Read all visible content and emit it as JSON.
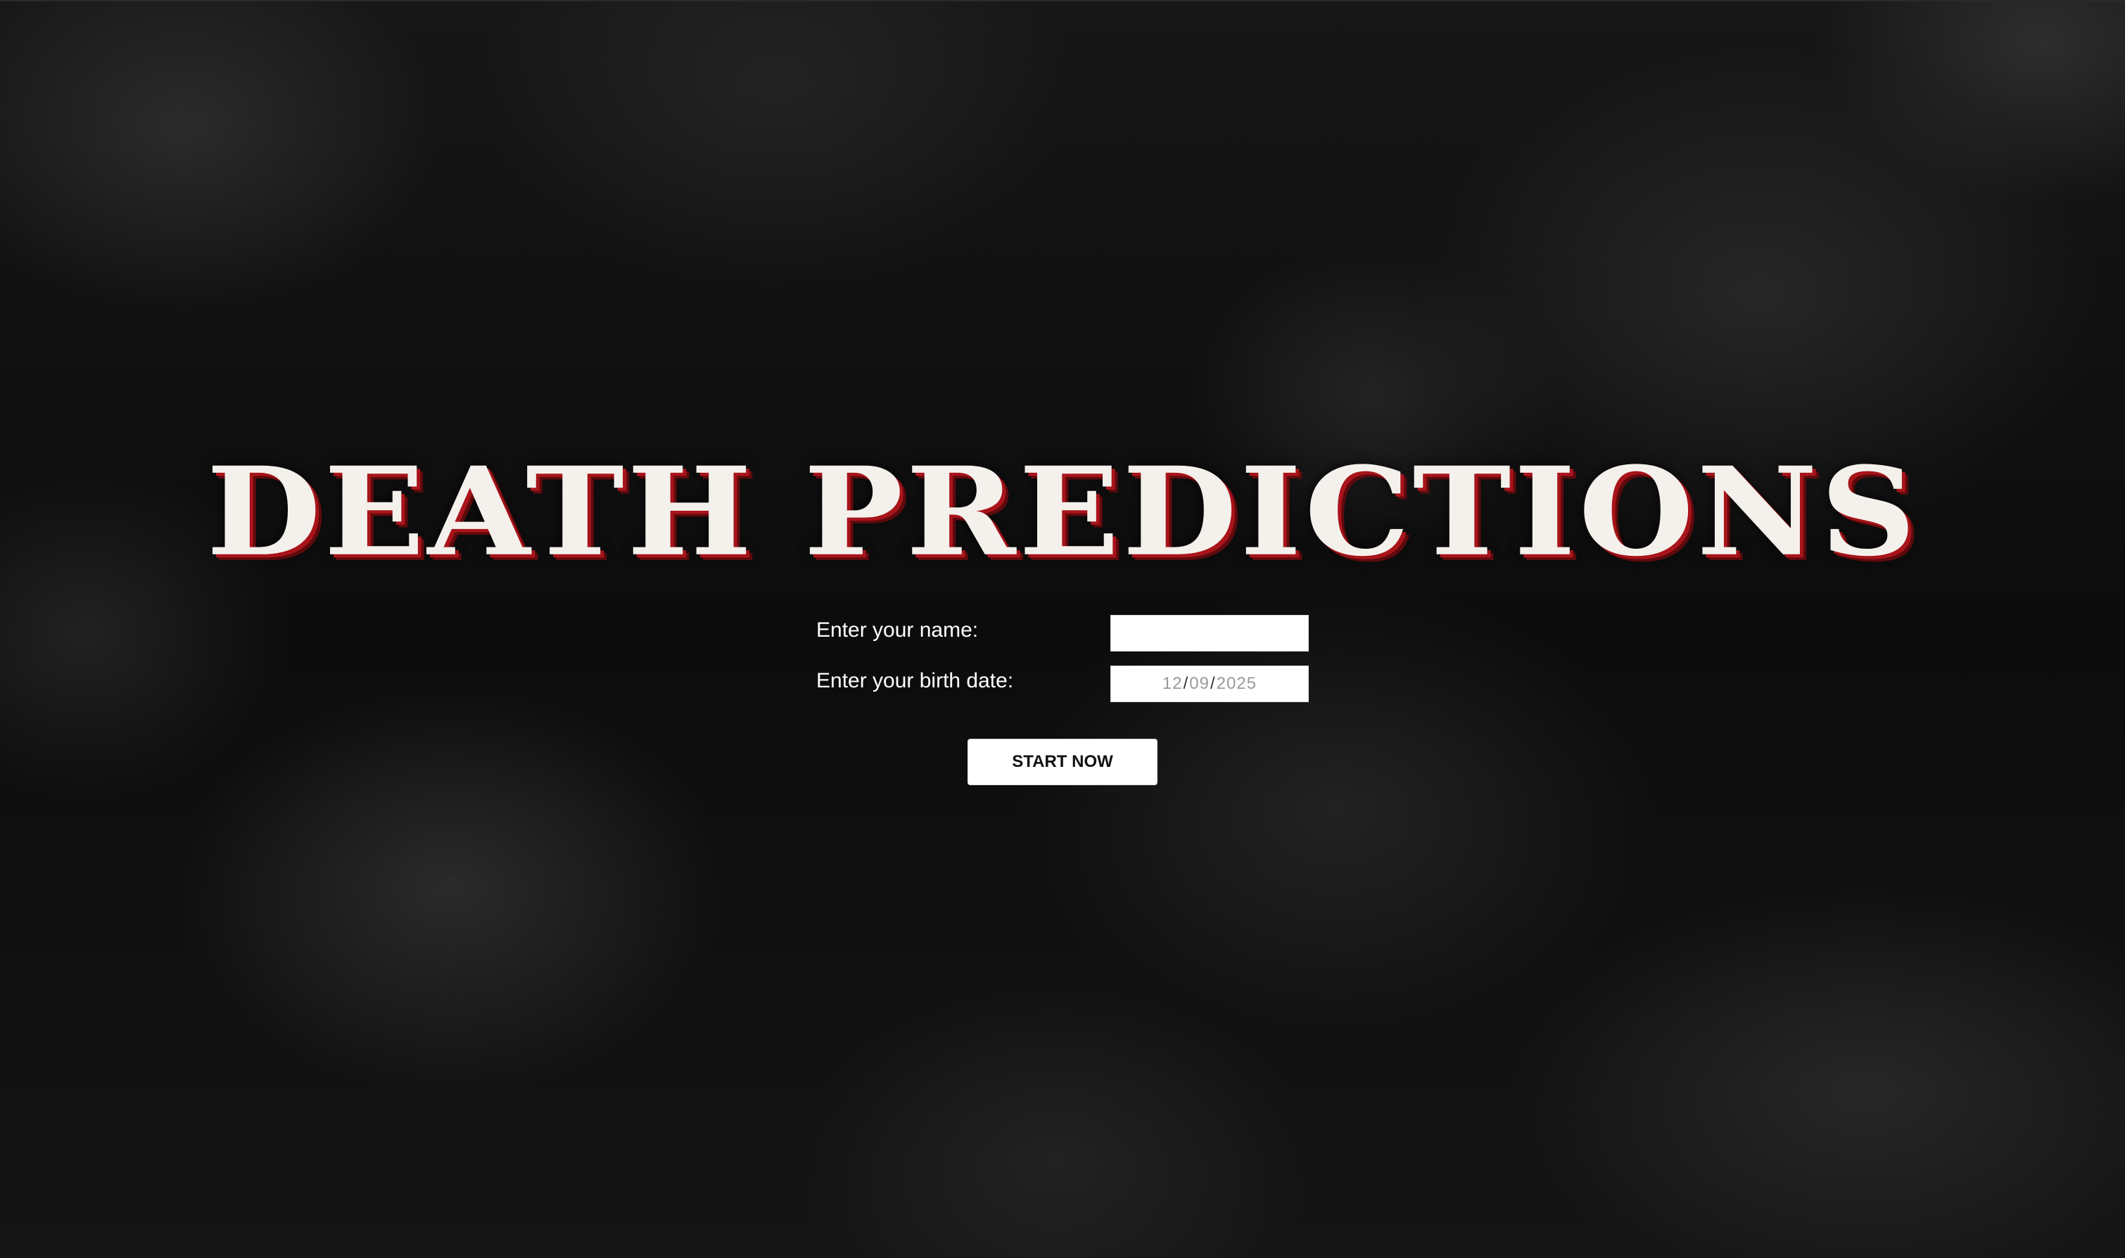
{
  "title": "DEATH PREDICTIONS",
  "form": {
    "name_label": "Enter your name:",
    "name_value": "",
    "birth_label": "Enter your birth date:",
    "birth_month": "12",
    "birth_day": "09",
    "birth_year": "2025",
    "date_separator": "/"
  },
  "start_button_label": "START NOW",
  "colors": {
    "background": "#121212",
    "title_fill": "#f4f1ec",
    "title_shadow": "#a8141a",
    "button_bg": "#ffffff",
    "button_text": "#111111"
  }
}
